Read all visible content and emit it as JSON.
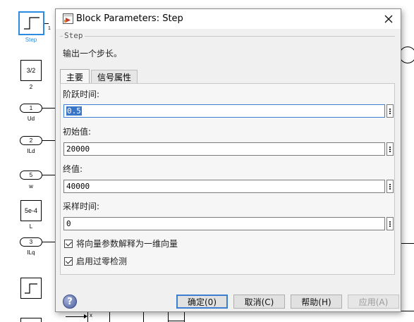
{
  "canvas": {
    "blocks": [
      {
        "label": "Step"
      },
      {
        "text": "3/2",
        "label": "2"
      },
      {
        "text": "1",
        "label": "Ud"
      },
      {
        "text": "2",
        "label": "ILd"
      },
      {
        "text": "5",
        "label": "w"
      },
      {
        "text": "5e-4",
        "label": "L"
      },
      {
        "text": "3",
        "label": "ILq"
      }
    ],
    "port_number": "1",
    "product_sign": "x"
  },
  "dialog": {
    "title": "Block Parameters: Step",
    "group_title": "Step",
    "description": "输出一个步长。",
    "tabs": [
      {
        "label": "主要",
        "active": true
      },
      {
        "label": "信号属性",
        "active": false
      }
    ],
    "fields": [
      {
        "label": "阶跃时间:",
        "value": "0.5"
      },
      {
        "label": "初始值:",
        "value": "20000"
      },
      {
        "label": "终值:",
        "value": "40000"
      },
      {
        "label": "采样时间:",
        "value": "0"
      }
    ],
    "checkboxes": [
      {
        "label": "将向量参数解释为一维向量",
        "checked": true
      },
      {
        "label": "启用过零检测",
        "checked": true
      }
    ],
    "buttons": {
      "ok": "确定(0)",
      "cancel": "取消(C)",
      "help": "帮助(H)",
      "apply": "应用(A)"
    }
  },
  "colors": {
    "selection_blue": "#2a8be0",
    "focus_blue": "#3c7fd0"
  }
}
